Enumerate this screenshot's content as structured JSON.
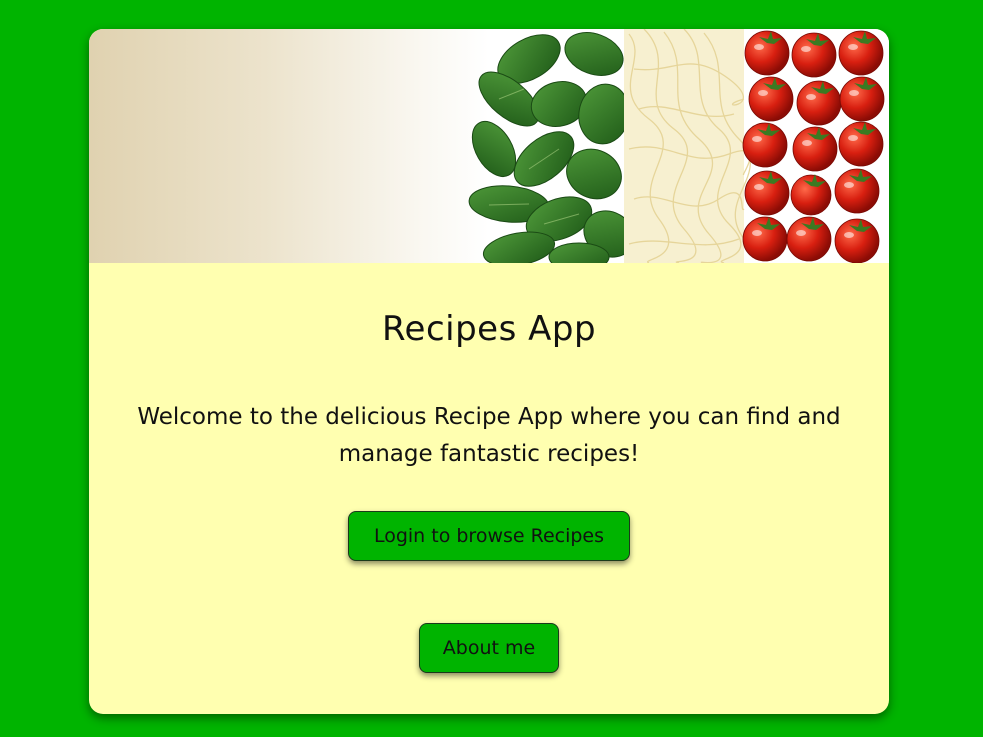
{
  "app": {
    "title": "Recipes App",
    "welcome_text": "Welcome to the delicious Recipe App where you can find and manage fantastic recipes!"
  },
  "hero": {
    "image_description": "basil-pasta-tomatoes-icon"
  },
  "buttons": {
    "login_label": "Login to browse Recipes",
    "about_label": "About me"
  },
  "colors": {
    "page_background": "#00b400",
    "card_background": "#ffffb0",
    "button_background": "#00b400",
    "tomato": "#d81f10",
    "basil": "#2f7a25"
  }
}
